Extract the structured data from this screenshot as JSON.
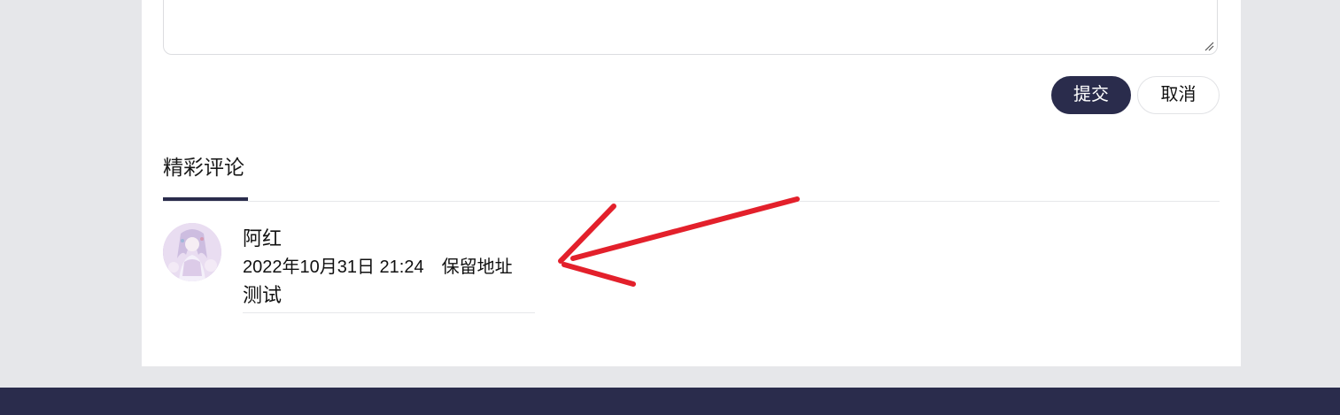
{
  "form": {
    "submit_label": "提交",
    "cancel_label": "取消"
  },
  "comments_section": {
    "title": "精彩评论",
    "comments": [
      {
        "author": "阿红",
        "date": "2022年10月31日 21:24",
        "location": "保留地址",
        "text": "测试"
      }
    ]
  },
  "colors": {
    "page_bg": "#e6e7ea",
    "accent_navy": "#2a2c4c",
    "annotation_red": "#e3202b"
  },
  "icons": [
    "resize-handle-icon",
    "avatar",
    "annotation-arrow"
  ]
}
